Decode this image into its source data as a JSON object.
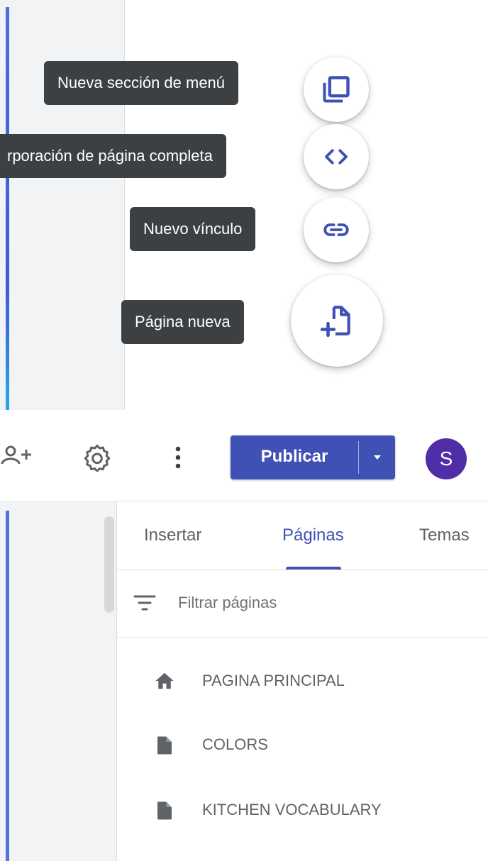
{
  "fab_menu": {
    "new_menu_section": "Nueva sección de menú",
    "full_page_embed": "rporación de página completa",
    "new_link": "Nuevo vínculo",
    "new_page": "Página nueva"
  },
  "toolbar": {
    "share_icon": "person-add-icon",
    "settings_icon": "gear-icon",
    "more_icon": "more-vert-icon",
    "publish_label": "Publicar",
    "avatar_letter": "S"
  },
  "tabs": [
    "Insertar",
    "Páginas",
    "Temas"
  ],
  "filter": {
    "placeholder": "Filtrar páginas"
  },
  "pages": [
    {
      "icon": "home-icon",
      "label": "PAGINA PRINCIPAL"
    },
    {
      "icon": "page-icon",
      "label": "COLORS"
    },
    {
      "icon": "page-icon",
      "label": "KITCHEN VOCABULARY"
    }
  ],
  "colors": {
    "accent": "#3f51b5",
    "avatar": "#512da8",
    "tooltip": "#3c4043"
  }
}
